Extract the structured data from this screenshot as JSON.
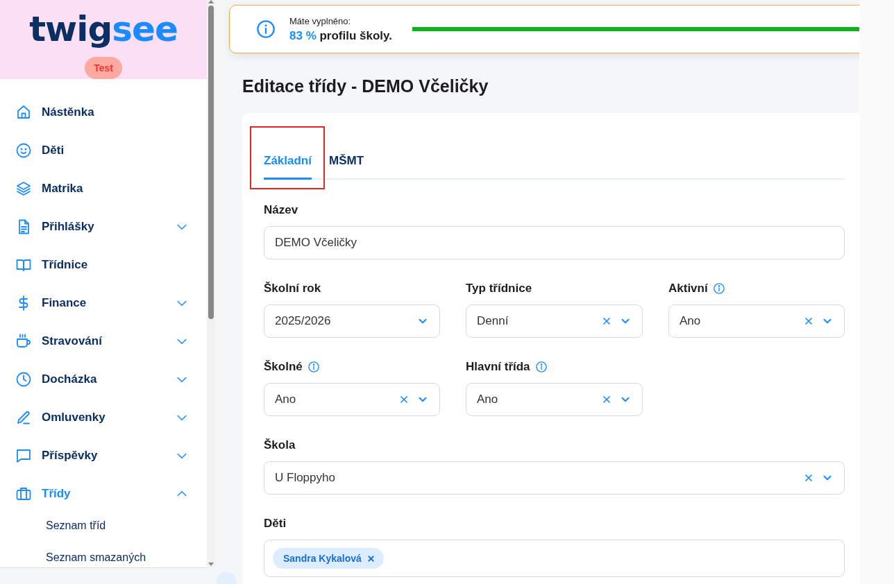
{
  "sidebar": {
    "logo": {
      "part_1": "twig",
      "part_2": "see"
    },
    "badge": "Test",
    "items": [
      {
        "label": "Nástěnka",
        "selected": false
      },
      {
        "label": "Děti",
        "selected": false
      },
      {
        "label": "Matrika",
        "selected": false
      },
      {
        "label": "Přihlášky",
        "selected": false,
        "expanded": false
      },
      {
        "label": "Třídnice",
        "selected": false
      },
      {
        "label": "Finance",
        "selected": false,
        "expanded": false
      },
      {
        "label": "Stravování",
        "selected": false,
        "expanded": false
      },
      {
        "label": "Docházka",
        "selected": false,
        "expanded": false
      },
      {
        "label": "Omluvenky",
        "selected": false,
        "expanded": false
      },
      {
        "label": "Příspěvky",
        "selected": false,
        "expanded": false
      },
      {
        "label": "Třídy",
        "selected": true,
        "expanded": true,
        "children": [
          {
            "label": "Seznam tříd"
          },
          {
            "label": "Seznam smazaných"
          }
        ]
      }
    ]
  },
  "banner": {
    "caption": "Máte vyplněno:",
    "percent": "83 %",
    "text": "profilu školy.",
    "level": 0.83
  },
  "page_title": "Editace třídy - DEMO Včeličky",
  "tabs": [
    {
      "label": "Základní",
      "selected": true,
      "highlighted": true
    },
    {
      "label": "MŠMT",
      "selected": false,
      "highlighted": false
    }
  ],
  "form_rows": [
    [
      {
        "kind": "text",
        "label": "Název",
        "value": "DEMO Včeličky",
        "info": false
      }
    ],
    [
      {
        "kind": "select",
        "label": "Školní rok",
        "value": "2025/2026",
        "info": false,
        "clearable": false
      },
      {
        "kind": "select",
        "label": "Typ třídnice",
        "value": "Denní",
        "info": false,
        "clearable": true
      },
      {
        "kind": "select",
        "label": "Aktivní",
        "value": "Ano",
        "info": true,
        "clearable": true
      }
    ],
    [
      {
        "kind": "select",
        "label": "Školné",
        "value": "Ano",
        "info": true,
        "clearable": true
      },
      {
        "kind": "select",
        "label": "Hlavní třída",
        "value": "Ano",
        "info": true,
        "clearable": true
      }
    ],
    [
      {
        "kind": "select",
        "label": "Škola",
        "value": "U Floppyho",
        "info": false,
        "clearable": true
      }
    ],
    [
      {
        "kind": "multiselect",
        "label": "Děti",
        "chips": [
          "Sandra Kykalová"
        ],
        "info": false
      }
    ]
  ]
}
